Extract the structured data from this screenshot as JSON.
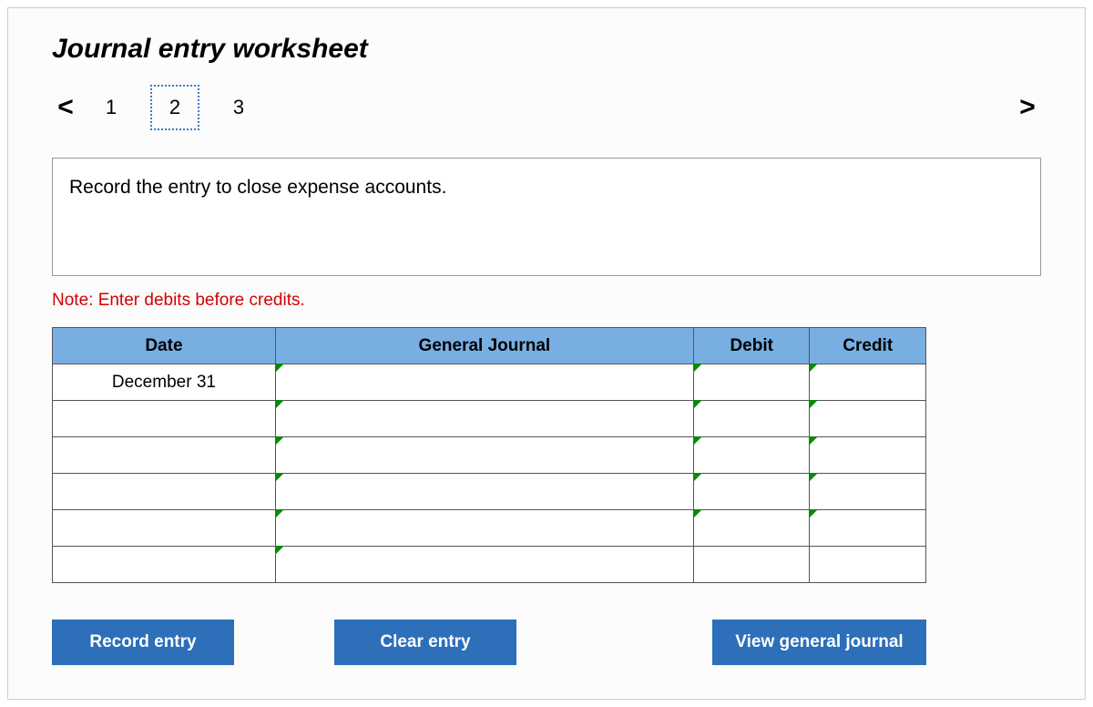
{
  "title": "Journal entry worksheet",
  "nav": {
    "prev": "<",
    "next": ">",
    "steps": [
      "1",
      "2",
      "3"
    ],
    "active_index": 1
  },
  "instructions": "Record the entry to close expense accounts.",
  "note": "Note: Enter debits before credits.",
  "table": {
    "headers": {
      "date": "Date",
      "journal": "General Journal",
      "debit": "Debit",
      "credit": "Credit"
    },
    "rows": [
      {
        "date": "December 31",
        "journal": "",
        "debit": "",
        "credit": ""
      },
      {
        "date": "",
        "journal": "",
        "debit": "",
        "credit": ""
      },
      {
        "date": "",
        "journal": "",
        "debit": "",
        "credit": ""
      },
      {
        "date": "",
        "journal": "",
        "debit": "",
        "credit": ""
      },
      {
        "date": "",
        "journal": "",
        "debit": "",
        "credit": ""
      },
      {
        "date": "",
        "journal": "",
        "debit": "",
        "credit": ""
      }
    ]
  },
  "buttons": {
    "record": "Record entry",
    "clear": "Clear entry",
    "view": "View general journal"
  }
}
